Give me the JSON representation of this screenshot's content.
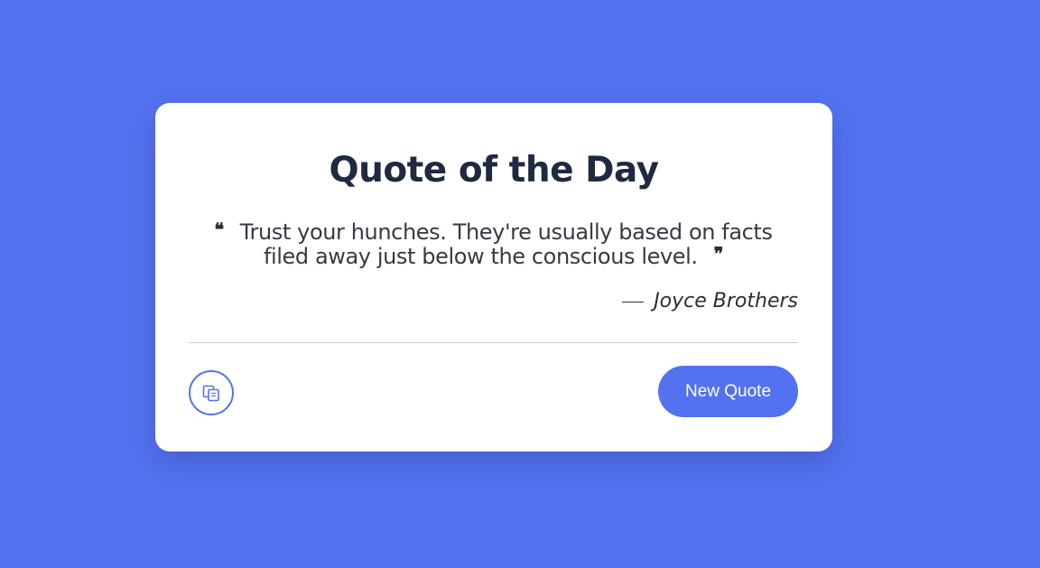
{
  "card": {
    "title": "Quote of the Day",
    "quote": {
      "open_mark": "❝",
      "text": "Trust your hunches. They're usually based on facts filed away just below the conscious level.",
      "close_mark": "❞"
    },
    "author": "Joyce Brothers",
    "actions": {
      "copy_icon": "copy-icon",
      "new_quote_label": "New Quote"
    }
  },
  "colors": {
    "background": "#5372ef",
    "accent": "#5372ef",
    "card": "#ffffff",
    "title_text": "#1f2940",
    "body_text": "#373a45"
  }
}
